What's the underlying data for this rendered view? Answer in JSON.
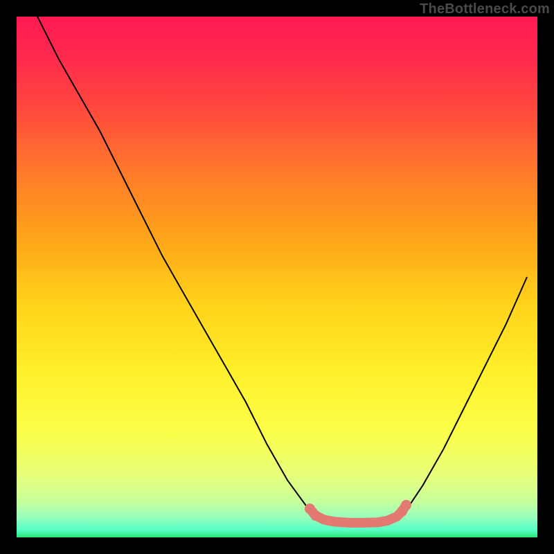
{
  "watermark": "TheBottleneck.com",
  "chart_data": {
    "type": "line",
    "title": "",
    "xlabel": "",
    "ylabel": "",
    "xlim": [
      0,
      100
    ],
    "ylim": [
      0,
      100
    ],
    "grid": false,
    "background_gradient_stops": [
      {
        "offset": 0.0,
        "color": "#ff1a52"
      },
      {
        "offset": 0.08,
        "color": "#ff2a4e"
      },
      {
        "offset": 0.18,
        "color": "#ff4a3c"
      },
      {
        "offset": 0.3,
        "color": "#ff7a2a"
      },
      {
        "offset": 0.42,
        "color": "#ffa31a"
      },
      {
        "offset": 0.55,
        "color": "#ffd21a"
      },
      {
        "offset": 0.68,
        "color": "#ffef2a"
      },
      {
        "offset": 0.8,
        "color": "#fbff4a"
      },
      {
        "offset": 0.88,
        "color": "#e8ff7a"
      },
      {
        "offset": 0.93,
        "color": "#c8ff9a"
      },
      {
        "offset": 0.96,
        "color": "#9affba"
      },
      {
        "offset": 0.985,
        "color": "#5affc8"
      },
      {
        "offset": 1.0,
        "color": "#2ae87a"
      }
    ],
    "series": [
      {
        "name": "bottleneck-curve",
        "stroke": "#000000",
        "points": [
          {
            "x": 4,
            "y": 100
          },
          {
            "x": 8,
            "y": 92
          },
          {
            "x": 12,
            "y": 85
          },
          {
            "x": 16,
            "y": 78
          },
          {
            "x": 20,
            "y": 70
          },
          {
            "x": 24,
            "y": 62
          },
          {
            "x": 28,
            "y": 54
          },
          {
            "x": 32,
            "y": 47
          },
          {
            "x": 36,
            "y": 40
          },
          {
            "x": 40,
            "y": 33
          },
          {
            "x": 44,
            "y": 26
          },
          {
            "x": 48,
            "y": 18
          },
          {
            "x": 52,
            "y": 11
          },
          {
            "x": 56,
            "y": 5.5
          },
          {
            "x": 58,
            "y": 3.6
          },
          {
            "x": 60,
            "y": 3.1
          },
          {
            "x": 64,
            "y": 2.8
          },
          {
            "x": 68,
            "y": 2.8
          },
          {
            "x": 71,
            "y": 3.0
          },
          {
            "x": 73,
            "y": 3.6
          },
          {
            "x": 75,
            "y": 5.5
          },
          {
            "x": 78,
            "y": 10
          },
          {
            "x": 82,
            "y": 17
          },
          {
            "x": 86,
            "y": 25
          },
          {
            "x": 90,
            "y": 33
          },
          {
            "x": 94,
            "y": 41
          },
          {
            "x": 98,
            "y": 50
          }
        ]
      }
    ],
    "highlight_band": {
      "name": "optimal-range",
      "color": "#e27a72",
      "points": [
        {
          "x": 56.3,
          "y": 5.5
        },
        {
          "x": 57.4,
          "y": 4.2
        },
        {
          "x": 59.0,
          "y": 3.4
        },
        {
          "x": 61.0,
          "y": 3.0
        },
        {
          "x": 64.0,
          "y": 2.8
        },
        {
          "x": 67.0,
          "y": 2.8
        },
        {
          "x": 69.5,
          "y": 2.9
        },
        {
          "x": 71.2,
          "y": 3.2
        },
        {
          "x": 73.0,
          "y": 4.0
        },
        {
          "x": 74.0,
          "y": 5.0
        },
        {
          "x": 74.8,
          "y": 6.2
        }
      ]
    }
  }
}
